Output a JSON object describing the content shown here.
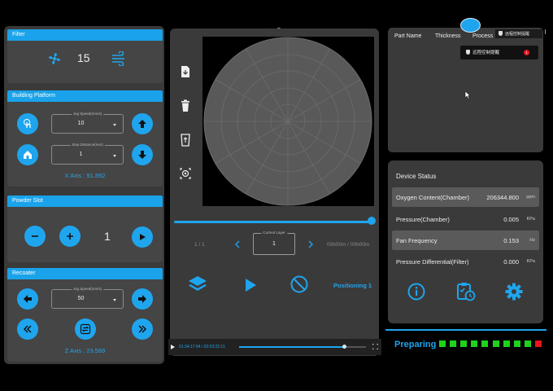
{
  "filter": {
    "title": "Filter",
    "speed": "15"
  },
  "building_platform": {
    "title": "Building Platform",
    "jog_label": "Jog Speed(mm/s)",
    "jog_value": "10",
    "step_label": "Step Distance(mm)",
    "step_value": "1",
    "axis_text": "X Axis : 91.892"
  },
  "powder_slot": {
    "title": "Powder Slot",
    "count": "1"
  },
  "recoater": {
    "title": "Recoater",
    "jog_label": "Jog Speed(mm/s)",
    "jog_value": "50",
    "axis_text": "Z Axis : 23.569"
  },
  "center": {
    "layer_count": "1 / 1",
    "current_layer_label": "Current Layer",
    "current_layer": "1",
    "time": "00h00m / 00h00m",
    "positioning": "Positioning 1",
    "slider_fraction": 1.0
  },
  "video": {
    "time": "01:34:17:04 / 02:03:22:11",
    "progress_fraction": 0.83
  },
  "parts": {
    "columns": [
      "Part Name",
      "Thickness",
      "Process"
    ]
  },
  "remote": {
    "menu_label": "远程控制提醒",
    "toast_label": "远程控制提醒",
    "badge": "1"
  },
  "device_status": {
    "title": "Device Status",
    "rows": [
      {
        "label": "Oxygen Content(Chamber)",
        "value": "206344.800",
        "unit": "ppm"
      },
      {
        "label": "Pressure(Chamber)",
        "value": "0.005",
        "unit": "KPa"
      },
      {
        "label": "Fan Frequency",
        "value": "0.153",
        "unit": "Hz"
      },
      {
        "label": "Pressure Differential(Filter)",
        "value": "0.000",
        "unit": "KPa"
      }
    ]
  },
  "footer": {
    "status": "Preparing",
    "indicators": [
      "green",
      "green",
      "green",
      "green",
      "green",
      "green",
      "green",
      "green",
      "green",
      "red"
    ]
  },
  "colors": {
    "accent": "#1fa5ee",
    "panel": "#3a3a3a",
    "ok": "#1ed21e",
    "error": "#e8141e"
  }
}
